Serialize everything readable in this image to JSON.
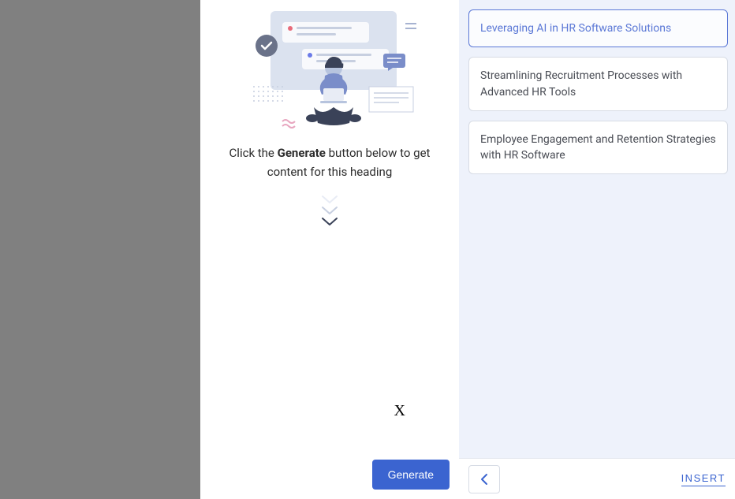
{
  "center": {
    "instruction_prefix": "Click the ",
    "instruction_bold": "Generate",
    "instruction_suffix": " button below to get content for this heading",
    "generate_label": "Generate",
    "x_mark": "X"
  },
  "right": {
    "suggestions": [
      {
        "label": "Leveraging AI in HR Software Solutions",
        "selected": true
      },
      {
        "label": "Streamlining Recruitment Processes with Advanced HR Tools",
        "selected": false
      },
      {
        "label": "Employee Engagement and Retention Strategies with HR Software",
        "selected": false
      }
    ],
    "insert_label": "INSERT"
  },
  "colors": {
    "accent": "#3b64d0",
    "panel_bg": "#eef2fb",
    "card_border": "#d7dce5",
    "selected_border": "#5b78d6"
  }
}
